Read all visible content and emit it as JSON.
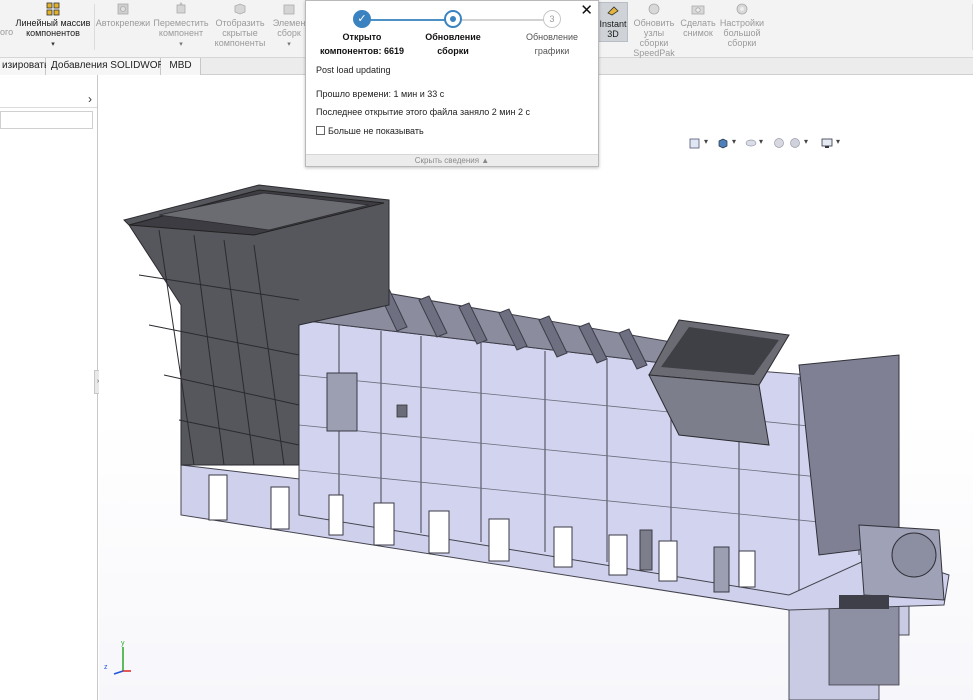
{
  "ribbon": {
    "partial_left_label": "ого",
    "linear_pattern": {
      "line1": "Линейный массив",
      "line2": "компонентов"
    },
    "autofasteners": "Автокрепежи",
    "move_component": {
      "line1": "Переместить",
      "line2": "компонент"
    },
    "show_hidden": {
      "line1": "Отобразить",
      "line2": "скрытые",
      "line3": "компоненты"
    },
    "elements_partial": {
      "line1": "Элемен",
      "line2": "сборк"
    },
    "instant3d": {
      "line1": "Instant",
      "line2": "3D"
    },
    "update_speedpak": {
      "line1": "Обновить",
      "line2": "узлы",
      "line3": "сборки",
      "line4": "SpeedPak"
    },
    "snapshot": {
      "line1": "Сделать",
      "line2": "снимок"
    },
    "large_assembly": {
      "line1": "Настройки",
      "line2": "большой",
      "line3": "сборки"
    }
  },
  "tabs": [
    {
      "label": "изировать"
    },
    {
      "label": "Добавления SOLIDWORKS"
    },
    {
      "label": "MBD"
    }
  ],
  "left_panel": {
    "chevron": "›"
  },
  "dialog": {
    "close_glyph": "✕",
    "steps": [
      {
        "line1": "Открыто",
        "line2": "компонентов: 6619",
        "state": "done",
        "glyph": "✓"
      },
      {
        "line1": "Обновление",
        "line2": "сборки",
        "state": "current",
        "glyph": ""
      },
      {
        "line1": "Обновление",
        "line2": "графики",
        "state": "pending",
        "glyph": "3"
      }
    ],
    "status": "Post load updating",
    "elapsed": "Прошло времени: 1 мин и 33 с",
    "last_open": "Последнее открытие этого файла заняло 2 мин 2 с",
    "checkbox_label": "Больше не показывать",
    "footer": "Скрыть сведения ▲"
  },
  "viewport": {
    "triad": {
      "x": "x",
      "y": "y",
      "z": "z"
    }
  },
  "colors": {
    "accent": "#3b83c0",
    "progress_pending": "#d2d2d2",
    "model_body": "#d4d6ee",
    "model_dark": "#555558"
  }
}
